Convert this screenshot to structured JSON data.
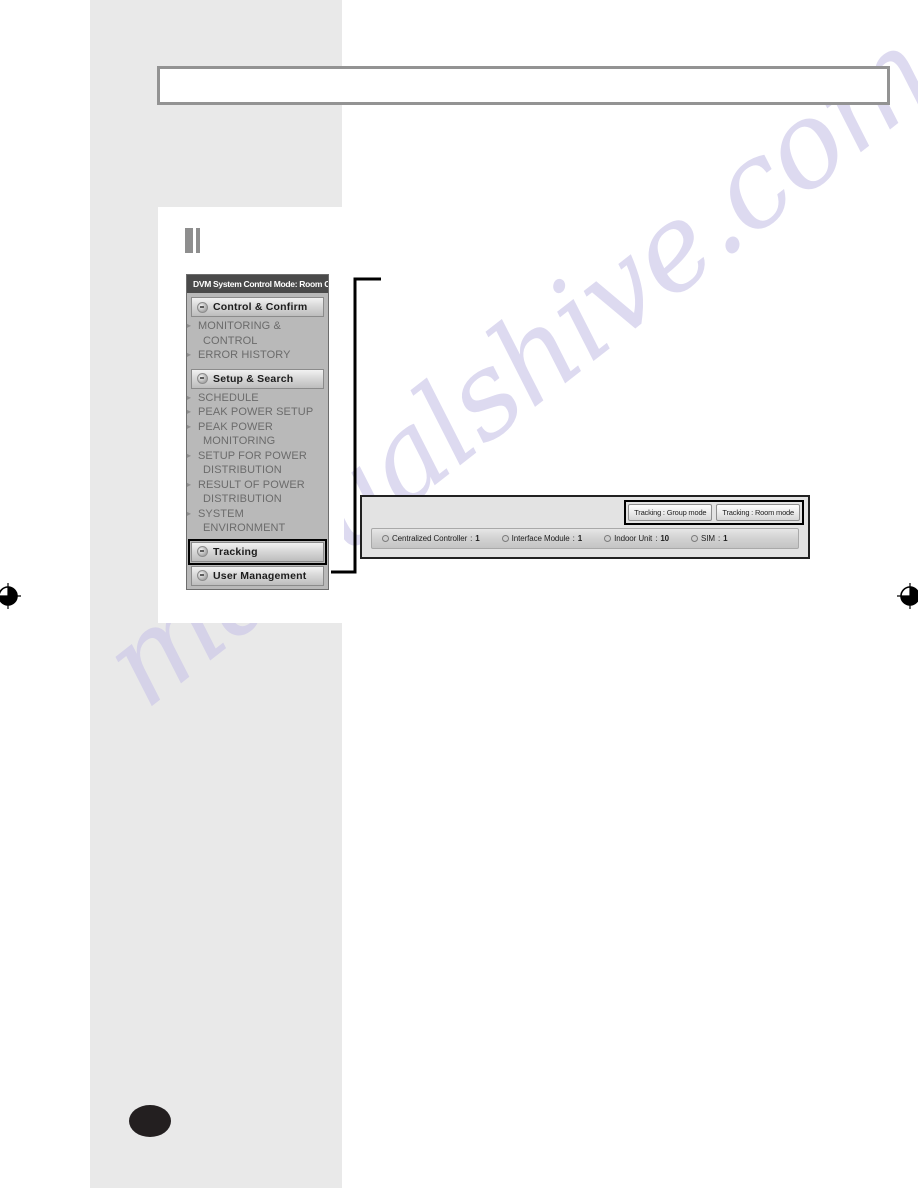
{
  "page": {
    "background_color": "#ffffff",
    "gray_column_color": "#e9e9e9",
    "watermark_text": "manualshive.com",
    "watermark_color": "#c9c4e8"
  },
  "header_box": {
    "content": ""
  },
  "app_window": {
    "title": "DVM System Control Mode: Room Control",
    "sections": [
      {
        "id": "control-confirm",
        "label": "Control & Confirm",
        "highlighted": false,
        "items": [
          {
            "label": "MONITORING & CONTROL"
          },
          {
            "label": "ERROR HISTORY"
          }
        ]
      },
      {
        "id": "setup-search",
        "label": "Setup & Search",
        "highlighted": false,
        "items": [
          {
            "label": "SCHEDULE"
          },
          {
            "label": "PEAK POWER SETUP"
          },
          {
            "label": "PEAK POWER MONITORING"
          },
          {
            "label": "SETUP FOR POWER DISTRIBUTION"
          },
          {
            "label": "RESULT OF POWER DISTRIBUTION"
          },
          {
            "label": "SYSTEM ENVIRONMENT"
          }
        ]
      },
      {
        "id": "tracking",
        "label": "Tracking",
        "highlighted": true,
        "items": []
      },
      {
        "id": "user-management",
        "label": "User Management",
        "highlighted": false,
        "items": []
      }
    ]
  },
  "detail_panel": {
    "buttons": [
      {
        "id": "tracking-group-mode",
        "label": "Tracking : Group mode"
      },
      {
        "id": "tracking-room-mode",
        "label": "Tracking : Room mode"
      }
    ],
    "status_items": [
      {
        "label": "Centralized Controller",
        "separator": ":",
        "value": "1"
      },
      {
        "label": "Interface Module",
        "separator": ":",
        "value": "1"
      },
      {
        "label": "Indoor Unit",
        "separator": ":",
        "value": "10"
      },
      {
        "label": "SIM",
        "separator": ":",
        "value": "1"
      }
    ]
  },
  "marks": {
    "registration_left": "registration-mark",
    "registration_right": "registration-mark",
    "page_bullet": ""
  }
}
